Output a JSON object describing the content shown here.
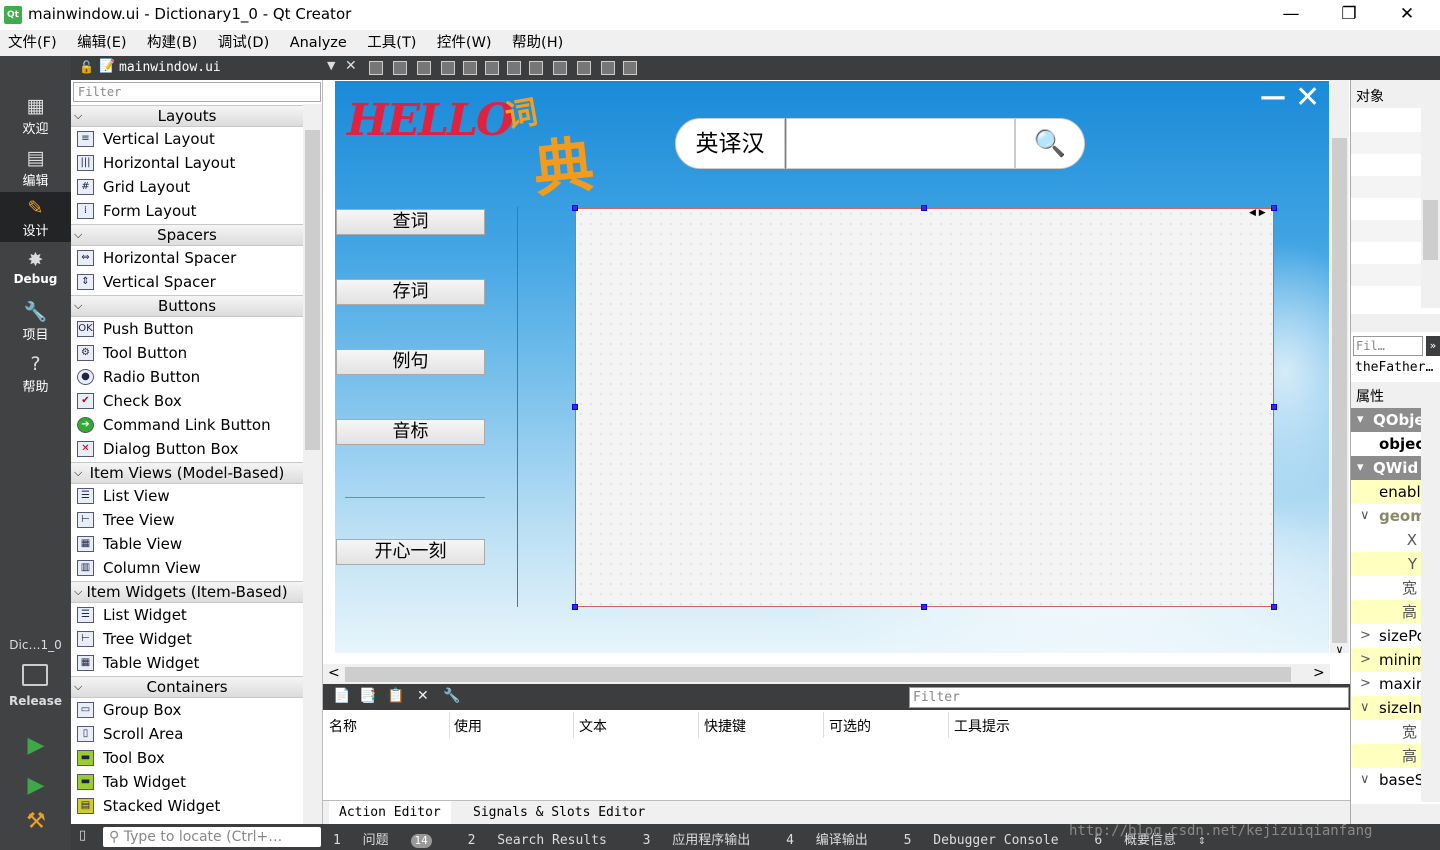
{
  "window": {
    "title": "mainwindow.ui - Dictionary1_0 - Qt Creator",
    "app_icon": "qt-icon",
    "minimize": "—",
    "restore": "❐",
    "close": "✕"
  },
  "menu": [
    "文件(F)",
    "编辑(E)",
    "构建(B)",
    "调试(D)",
    "Analyze",
    "工具(T)",
    "控件(W)",
    "帮助(H)"
  ],
  "modes": [
    {
      "icon": "grid-icon",
      "label": "欢迎"
    },
    {
      "icon": "edit-icon",
      "label": "编辑"
    },
    {
      "icon": "pencil-icon",
      "label": "设计"
    },
    {
      "icon": "bug-icon",
      "label": "Debug"
    },
    {
      "icon": "wrench-icon",
      "label": "项目"
    },
    {
      "icon": "help-icon",
      "label": "帮助"
    }
  ],
  "kit": {
    "project": "Dic…1_0",
    "config": "Release"
  },
  "doc_tab": {
    "filename": "mainwindow.ui"
  },
  "widget_box": {
    "filter_placeholder": "Filter",
    "categories": [
      {
        "name": "Layouts",
        "items": [
          "Vertical Layout",
          "Horizontal Layout",
          "Grid Layout",
          "Form Layout"
        ]
      },
      {
        "name": "Spacers",
        "items": [
          "Horizontal Spacer",
          "Vertical Spacer"
        ]
      },
      {
        "name": "Buttons",
        "items": [
          "Push Button",
          "Tool Button",
          "Radio Button",
          "Check Box",
          "Command Link Button",
          "Dialog Button Box"
        ]
      },
      {
        "name": "Item Views (Model-Based)",
        "items": [
          "List View",
          "Tree View",
          "Table View",
          "Column View"
        ]
      },
      {
        "name": "Item Widgets (Item-Based)",
        "items": [
          "List Widget",
          "Tree Widget",
          "Table Widget"
        ]
      },
      {
        "name": "Containers",
        "items": [
          "Group Box",
          "Scroll Area",
          "Tool Box",
          "Tab Widget",
          "Stacked Widget"
        ]
      }
    ]
  },
  "form": {
    "logo_hello": "HELLO",
    "logo_ci": "词",
    "logo_dian": "典",
    "lang_button": "英译汉",
    "search_value": "",
    "nav_buttons": [
      "查词",
      "存词",
      "例句",
      "音标",
      "开心一刻"
    ]
  },
  "action_editor": {
    "filter_placeholder": "Filter",
    "columns": [
      "名称",
      "使用",
      "文本",
      "快捷键",
      "可选的",
      "工具提示"
    ],
    "tabs": [
      "Action Editor",
      "Signals & Slots Editor"
    ]
  },
  "object_inspector": {
    "header": "对象",
    "filter_placeholder": "Fil…",
    "class_label": "theFather…"
  },
  "property_editor": {
    "header": "属性",
    "rows": [
      {
        "type": "group",
        "text": "QObje"
      },
      {
        "type": "bold",
        "text": "objec"
      },
      {
        "type": "group",
        "text": "QWid"
      },
      {
        "type": "y",
        "text": "enabl"
      },
      {
        "type": "expand",
        "text": "geom"
      },
      {
        "type": "sub-w",
        "text": "X"
      },
      {
        "type": "sub-y",
        "text": "Y"
      },
      {
        "type": "sub-w",
        "text": "宽"
      },
      {
        "type": "sub-y",
        "text": "高"
      },
      {
        "type": "collapsed-w",
        "text": "sizePo"
      },
      {
        "type": "collapsed-y",
        "text": "minim"
      },
      {
        "type": "collapsed-w",
        "text": "maxir"
      },
      {
        "type": "expand-y",
        "text": "sizeIn"
      },
      {
        "type": "sub-w",
        "text": "宽"
      },
      {
        "type": "sub-y",
        "text": "高"
      },
      {
        "type": "collapsed-w",
        "text": "baseS"
      }
    ]
  },
  "locator": {
    "placeholder": "Type to locate (Ctrl+…"
  },
  "output_tabs": [
    {
      "num": "1",
      "label": "问题",
      "badge": "14"
    },
    {
      "num": "2",
      "label": "Search Results"
    },
    {
      "num": "3",
      "label": "应用程序输出"
    },
    {
      "num": "4",
      "label": "编译输出"
    },
    {
      "num": "5",
      "label": "Debugger Console"
    },
    {
      "num": "6",
      "label": "概要信息"
    }
  ],
  "watermark": "http://blog.csdn.net/kejizuiqianfang"
}
